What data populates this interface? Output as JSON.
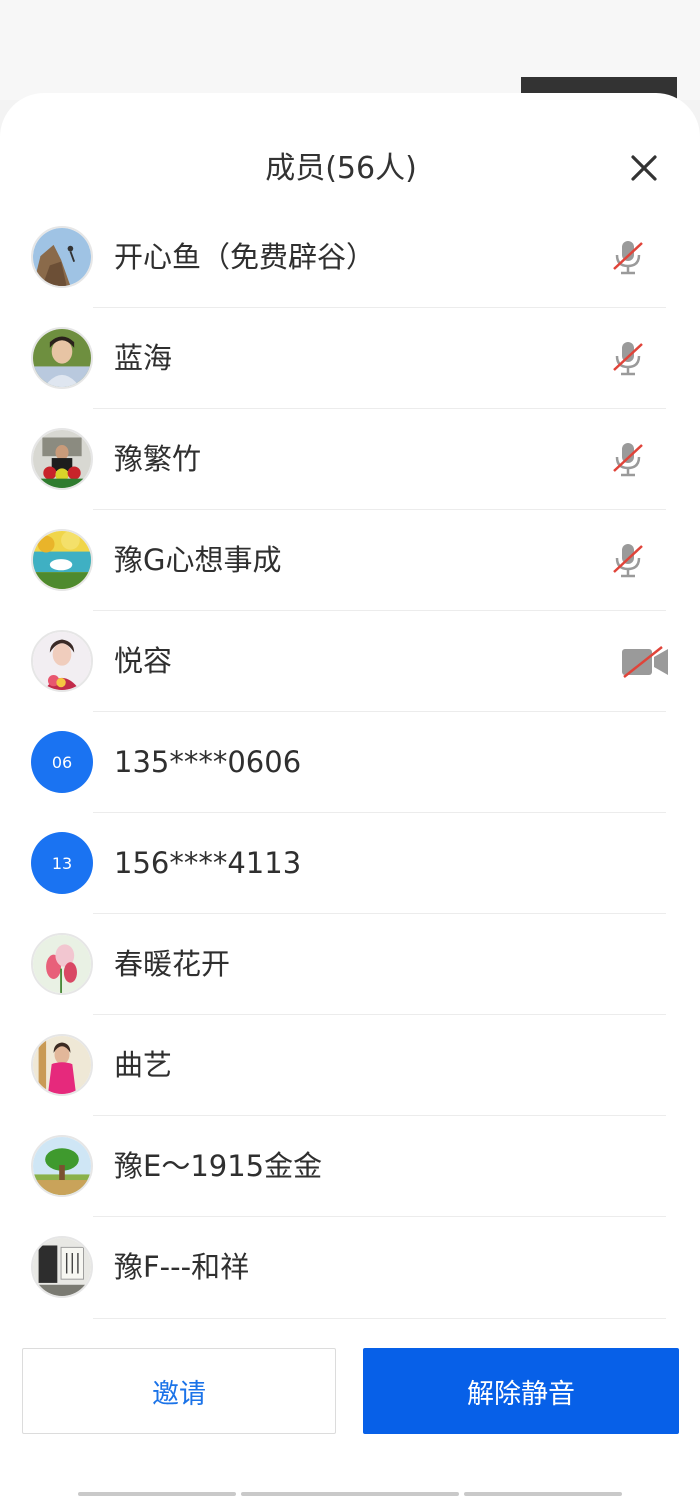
{
  "header": {
    "title": "成员(56人)"
  },
  "members": [
    {
      "name": "开心鱼（免费辟谷）",
      "status": "mic-muted-icon"
    },
    {
      "name": "蓝海",
      "status": "mic-muted-icon"
    },
    {
      "name": "豫繁竹",
      "status": "mic-muted-icon"
    },
    {
      "name": "豫G心想事成",
      "status": "mic-muted-icon"
    },
    {
      "name": "悦容",
      "status": "video-off-icon"
    },
    {
      "name": "135****0606",
      "avatar_text": "06"
    },
    {
      "name": "156****4113",
      "avatar_text": "13"
    },
    {
      "name": "春暖花开"
    },
    {
      "name": "曲艺"
    },
    {
      "name": "豫E～1915金金"
    },
    {
      "name": "豫F---和祥"
    }
  ],
  "actions": {
    "invite_label": "邀请",
    "unmute_label": "解除静音"
  },
  "colors": {
    "accent_blue": "#0760e8",
    "link_blue": "#1b73e8",
    "avatar_blue": "#1a73f2",
    "muted_red": "#e0443a",
    "icon_gray": "#9a9a9a"
  }
}
